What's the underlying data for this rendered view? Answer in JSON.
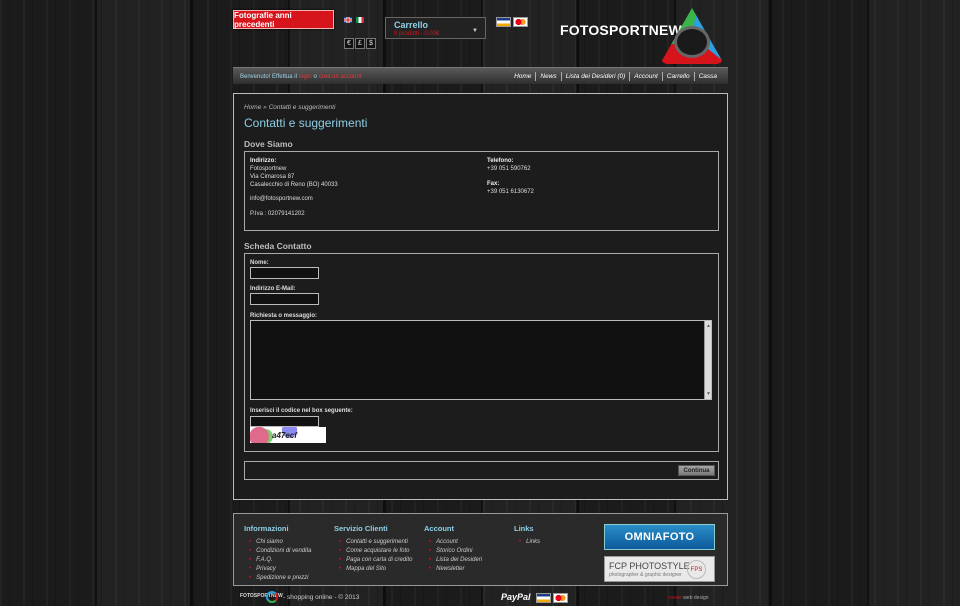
{
  "header": {
    "prev_photos_button": "Fotografie anni precedenti",
    "currencies": [
      "€",
      "£",
      "$"
    ],
    "cart": {
      "title": "Carrello",
      "subtitle": "0 prodotti - 0.00€"
    },
    "logo_text": "FOTOSPORTNEW"
  },
  "nav": {
    "welcome_prefix": "Benvenuto! Effettua il",
    "login": "login",
    "or": "o",
    "register": "crea un account",
    "items": [
      "Home",
      "News",
      "Lista dei Desideri (0)",
      "Account",
      "Carrello",
      "Cassa"
    ]
  },
  "main": {
    "breadcrumb": "Home » Contatti e suggerimenti",
    "title": "Contatti e suggerimenti",
    "dove_siamo": {
      "heading": "Dove Siamo",
      "address_label": "Indirizzo:",
      "address_lines": [
        "Fotosportnew",
        "Via Cimarosa 87",
        "Casalecchio di Reno (BO) 40033"
      ],
      "email": "info@fotosportnew.com",
      "piva": "P.Iva : 02079141202",
      "tel_label": "Telefono:",
      "tel": "+39 051 590762",
      "fax_label": "Fax:",
      "fax": "+39 051 6130672"
    },
    "form": {
      "heading": "Scheda Contatto",
      "name_label": "Nome:",
      "name_value": "",
      "email_label": "Indirizzo E-Mail:",
      "email_value": "",
      "message_label": "Richiesta o messaggio:",
      "message_value": "",
      "code_label": "Inserisci il codice nel box seguente:",
      "code_value": "",
      "captcha_text": "a47ecf",
      "submit": "Continua"
    }
  },
  "footer": {
    "columns": [
      {
        "title": "Informazioni",
        "items": [
          "Chi siamo",
          "Condizioni di vendita",
          "F.A.Q.",
          "Privacy",
          "Spedizione e prezzi"
        ]
      },
      {
        "title": "Servizio Clienti",
        "items": [
          "Contatti e suggerimenti",
          "Come acquistare le foto",
          "Paga con carta di credito",
          "Mappa del Sito"
        ]
      },
      {
        "title": "Account",
        "items": [
          "Account",
          "Storico Ordini",
          "Lista dei Desideri",
          "Newsletter"
        ]
      },
      {
        "title": "Links",
        "items": [
          "Links"
        ]
      }
    ],
    "banner_omnia": "OMNIAFOTO",
    "banner_fcp": "FCP PHOTOSTYLE",
    "banner_fcp_sub": "photographer & graphic designer",
    "banner_fcp_mark": "FPS",
    "bottom_logo": "FOTOSPORTNEW",
    "shop_online": "- shopping online - © 2013",
    "paypal": "PayPal",
    "credits_a": "creato",
    "credits_b": "web design"
  }
}
